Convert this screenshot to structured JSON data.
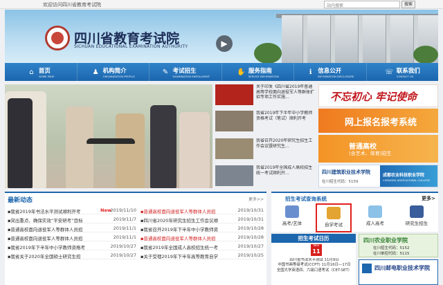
{
  "topbar": {
    "welcome": "欢迎访问四川省教育考试院",
    "search_placeholder": "站内搜索",
    "search_button": "搜索"
  },
  "banner": {
    "title_cn": "四川省教育考试院",
    "title_en": "SICHUAN EDUCATIONAL EXAMINATION AUTHORITY"
  },
  "nav": [
    {
      "cn": "首页",
      "en": "HOME PAGE",
      "icon": "home-icon"
    },
    {
      "cn": "机构简介",
      "en": "ORGANIZATION PROFILE",
      "icon": "people-icon"
    },
    {
      "cn": "考试招生",
      "en": "EXAMINATION ENROLLMENT",
      "icon": "pencil-icon"
    },
    {
      "cn": "服务指南",
      "en": "SERVICE INFORMATION",
      "icon": "hands-icon"
    },
    {
      "cn": "信息公开",
      "en": "INFORMATION DISCLOSURE",
      "icon": "info-icon"
    },
    {
      "cn": "联系我们",
      "en": "CONTACT US",
      "icon": "phone-icon"
    }
  ],
  "photo_news": [
    {
      "text": "关于印发《四川省2019年普通高等学校面向退役军人等群体扩招专项工作实施..."
    },
    {
      "text": "我省2019年下半年中小学教师资格考试（笔试）顺利开考"
    },
    {
      "text": "我省召开2020年研究生招生工作会议暨研究生..."
    },
    {
      "text": "我省2019年全国成人高校招生统一考试顺利开..."
    }
  ],
  "right_banners": {
    "slogan": "不忘初心 牢记使命",
    "online_signup": "网上报名报考系统",
    "college_title": "普通高校",
    "college_sub": "(含艺术、体育)招生",
    "college_name": "四川建筑职业技术学院",
    "college_code": "在川招生代码：5159",
    "college2_name": "成都农业科技职业学院",
    "college2_en": "CHENGDU AGRICULTURAL COLLEGE"
  },
  "news": {
    "title": "最新动态",
    "more": "更多>>",
    "new_label": "New",
    "left": [
      {
        "text": "▪我省2019年书法水平测试顺利开考",
        "date": "2019/11/10",
        "new": true
      },
      {
        "text": "▪突出重点、确保实效“平安研考”目标",
        "date": "2019/11/7"
      },
      {
        "text": "▪普通高校面向退役军人等群体人员招",
        "date": "2019/11/1"
      },
      {
        "text": "▪普通高校面向退役军人等群体人员招",
        "date": "2019/11/1"
      },
      {
        "text": "▪我省2019年下半年中小学教师资格考",
        "date": "2019/10/27"
      },
      {
        "text": "▪我省关于2020年全国硕士研究生招",
        "date": "2019/10/27"
      }
    ],
    "right": [
      {
        "text": "▪普通高校面向退役军人等群体人员招",
        "date": "2019/10/31",
        "hot": true
      },
      {
        "text": "▪四川省2020年研究生招生工作会议顺",
        "date": "2019/10/31"
      },
      {
        "text": "▪我省召开2019年下半年中小学教师资",
        "date": "2019/10/28"
      },
      {
        "text": "▪普通高校面向退役军人等群体人员招",
        "date": "2019/10/28",
        "hot": true
      },
      {
        "text": "▪我省2019年全国成人高校招生统一考",
        "date": "2019/10/27"
      },
      {
        "text": "▪关于受理2019年下半年高等教育自学",
        "date": "2019/10/25"
      }
    ]
  },
  "query": {
    "title": "招生考试查询系统",
    "more": "更多>",
    "items": [
      {
        "label": "高考/艺体",
        "icon": "trophy-icon",
        "color": "#6a8fcf"
      },
      {
        "label": "自学考试",
        "icon": "book-icon",
        "color": "#e3a431",
        "selected": true
      },
      {
        "label": "成人高考",
        "icon": "paper-icon",
        "color": "#8cc1e8"
      },
      {
        "label": "研究生招生",
        "icon": "graduation-cap-icon",
        "color": "#3a5d9c"
      }
    ]
  },
  "calendar": {
    "header": "招生考试日历",
    "month": "Nov",
    "day": "11",
    "lines": [
      "四川省书法水平测试 11月9日",
      "中国书画等级考试(CCPT) 11月16日—17日",
      "全国大学英语四、六级口语考试（CET-SET）"
    ]
  },
  "side_ads": {
    "ad1_title": "四川农业职业学院",
    "ad1_line1": "在川招生代码：5152",
    "ad1_line2": "在川单招代码：5115",
    "ad2_title": "四川邮电职业技术学院"
  }
}
